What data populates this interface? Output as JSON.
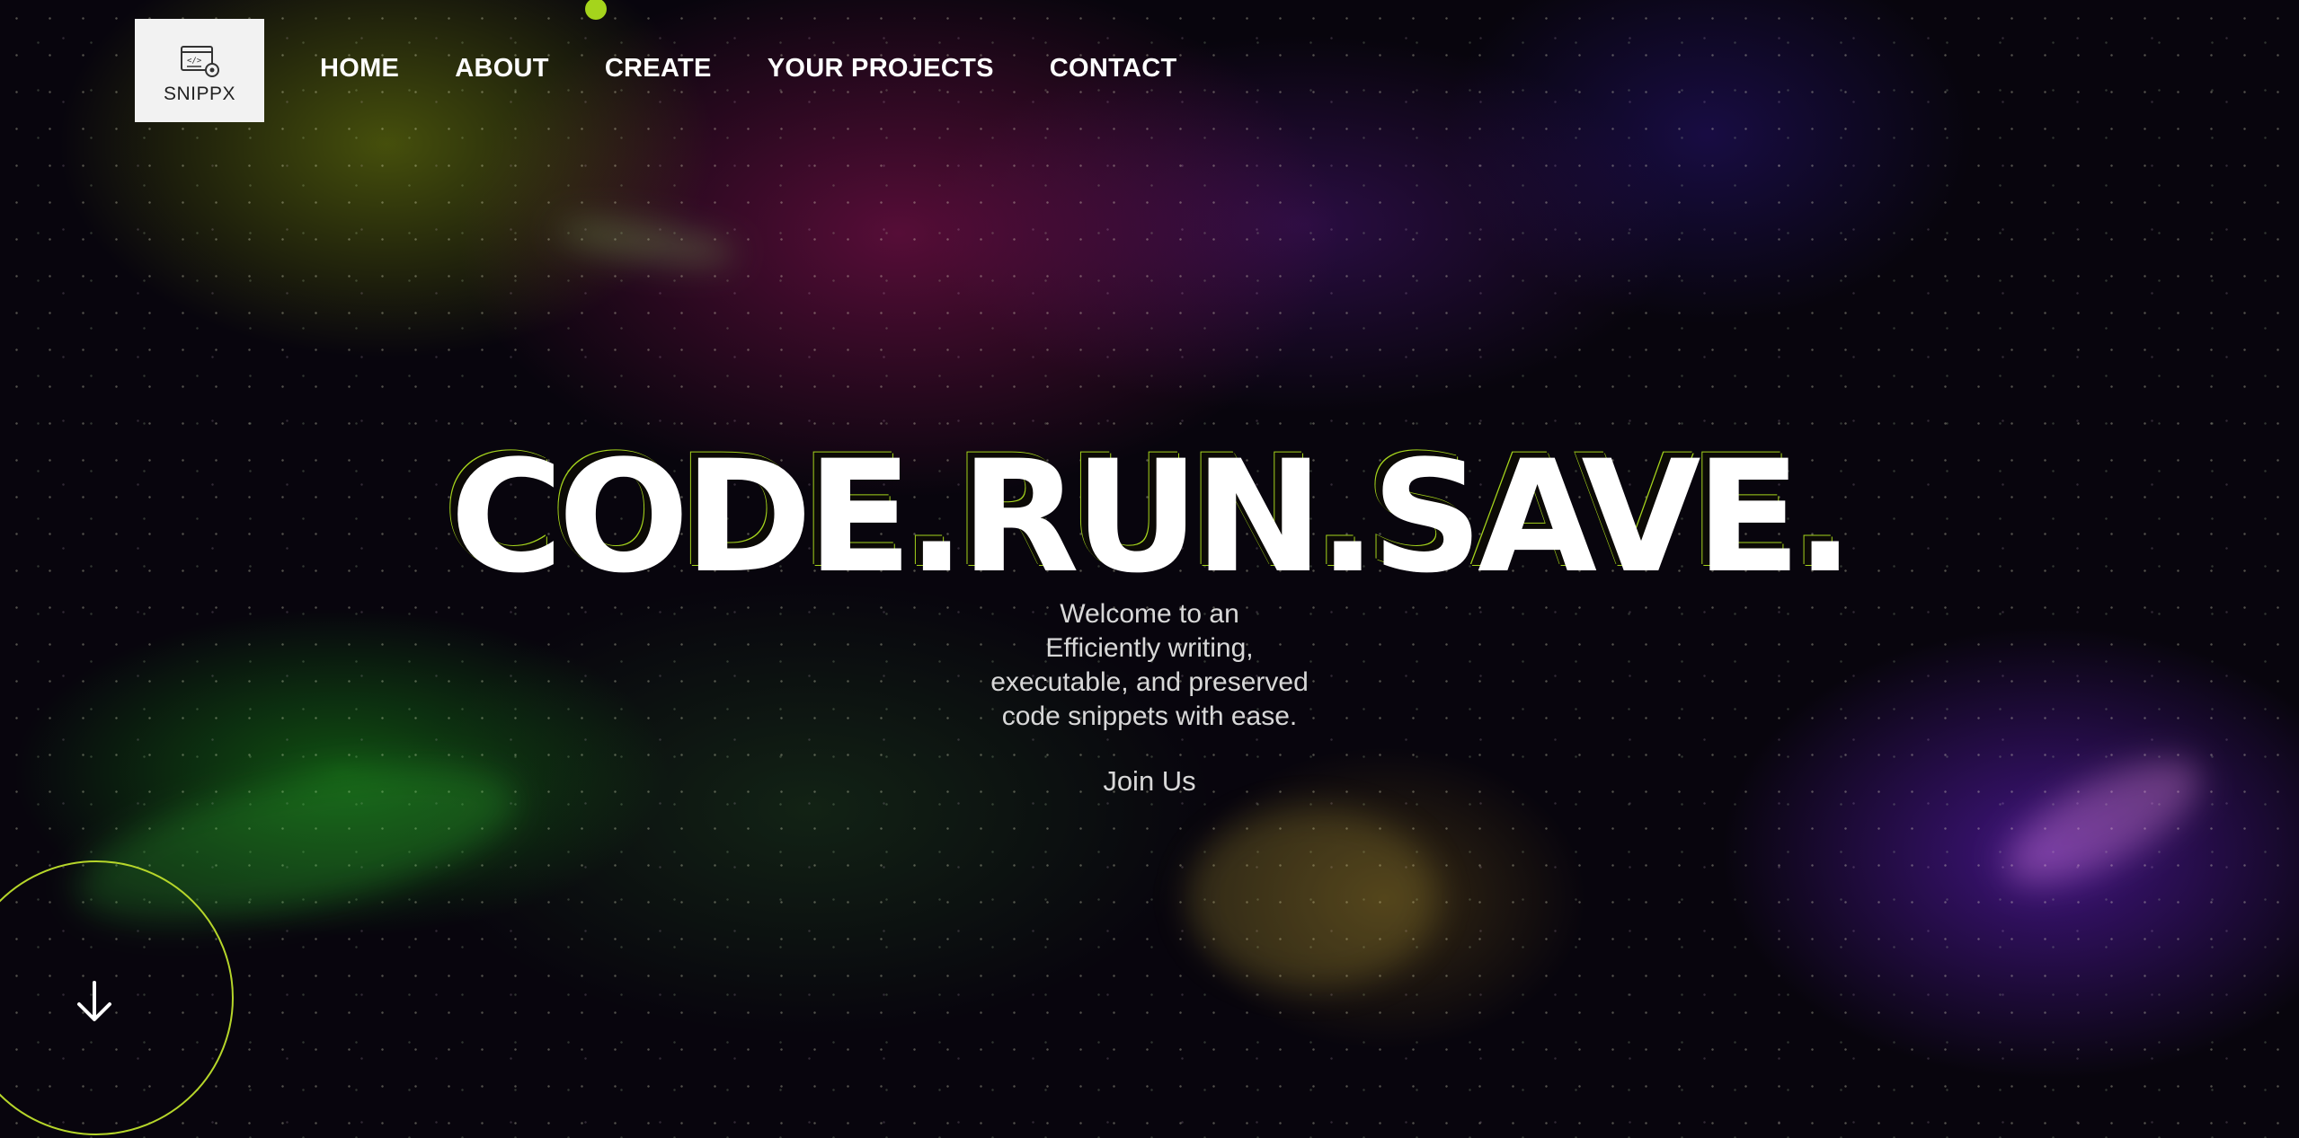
{
  "brand": {
    "name": "SNIPPX",
    "accent_color": "#a5d41c"
  },
  "nav": {
    "items": [
      {
        "label": "HOME"
      },
      {
        "label": "ABOUT"
      },
      {
        "label": "CREATE"
      },
      {
        "label": "YOUR PROJECTS"
      },
      {
        "label": "CONTACT"
      }
    ]
  },
  "hero": {
    "title": "CODE.RUN.SAVE.",
    "tagline_lines": [
      "Welcome to an",
      "Efficiently writing,",
      "executable, and preserved",
      "code snippets with ease."
    ],
    "cta_label": "Join Us"
  },
  "icons": {
    "logo": "code-window-gear-icon",
    "scroll": "arrow-down-icon"
  }
}
